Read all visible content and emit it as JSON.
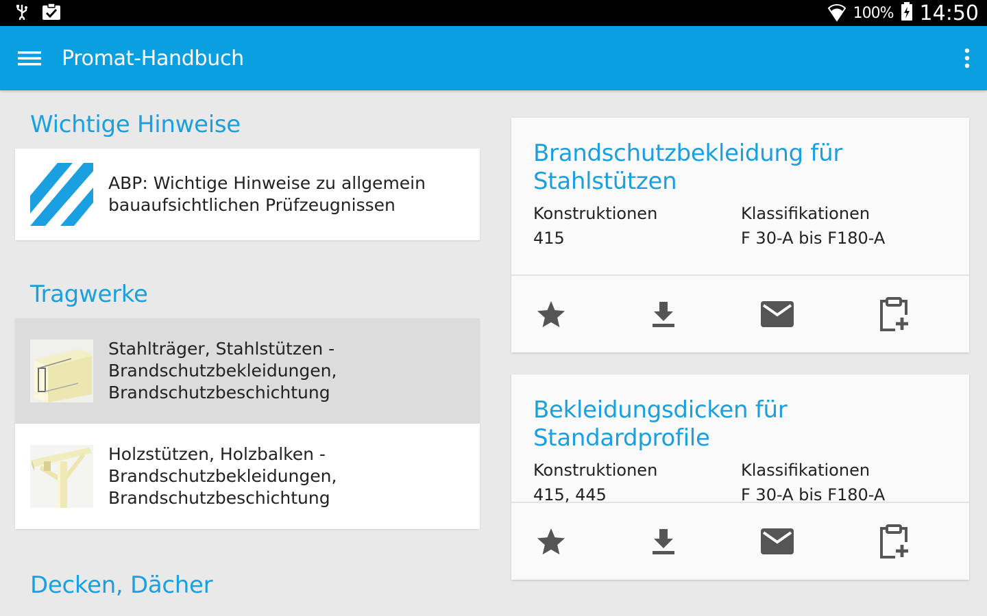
{
  "status_bar": {
    "battery_percent": "100%",
    "time": "14:50",
    "icons": [
      "usb-icon",
      "clipboard-check-icon",
      "wifi-icon",
      "battery-charging-icon"
    ]
  },
  "app_bar": {
    "title": "Promat-Handbuch",
    "color": "#0aa0e0"
  },
  "sections": [
    {
      "title": "Wichtige Hinweise",
      "items": [
        {
          "line1": "ABP: Wichtige Hinweise zu allgemein",
          "line2": "bauaufsichtlichen Prüfzeugnissen"
        }
      ]
    },
    {
      "title": "Tragwerke",
      "items": [
        {
          "line1": "Stahlträger, Stahlstützen -",
          "line2": "Brandschutzbekleidungen,",
          "line3": "Brandschutzbeschichtung",
          "selected": true
        },
        {
          "line1": "Holzstützen, Holzbalken -",
          "line2": "Brandschutzbekleidungen,",
          "line3": "Brandschutzbeschichtung"
        }
      ]
    },
    {
      "title": "Decken, Dächer"
    }
  ],
  "cards": [
    {
      "title_line1": "Brandschutzbekleidung für",
      "title_line2": "Stahlstützen",
      "konstruktionen_label": "Konstruktionen",
      "konstruktionen_value": "415",
      "klassifikationen_label": "Klassifikationen",
      "klassifikationen_value": "F 30-A bis F180-A"
    },
    {
      "title_line1": "Bekleidungsdicken für Standardprofile",
      "konstruktionen_label": "Konstruktionen",
      "konstruktionen_value": "415, 445",
      "klassifikationen_label": "Klassifikationen",
      "klassifikationen_value": "F 30-A bis F180-A"
    }
  ],
  "colors": {
    "accent": "#1a9fe0",
    "background": "#e9e9e9",
    "selected_row": "#dcdcdc",
    "icon_gray": "#555555"
  }
}
